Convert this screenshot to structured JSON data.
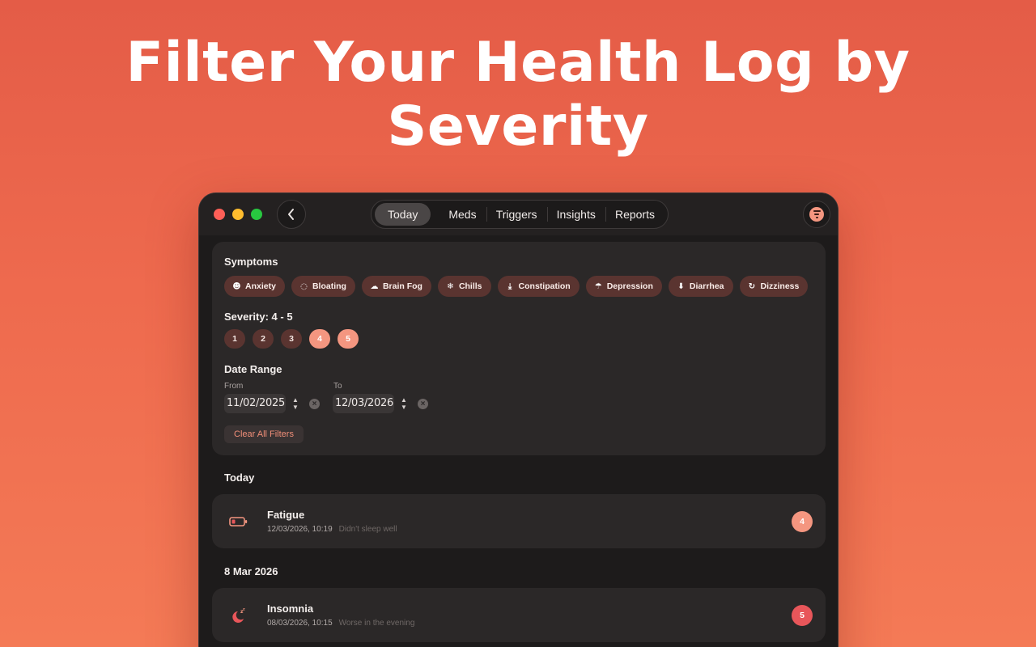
{
  "headline": "Filter Your Health Log by Severity",
  "window": {
    "tabs": [
      {
        "label": "Today",
        "active": true
      },
      {
        "label": "Meds",
        "active": false
      },
      {
        "label": "Triggers",
        "active": false
      },
      {
        "label": "Insights",
        "active": false
      },
      {
        "label": "Reports",
        "active": false
      }
    ],
    "back_icon": "chevron-left-icon",
    "filter_icon": "filter-lines-icon"
  },
  "filters": {
    "symptoms_title": "Symptoms",
    "symptoms": [
      {
        "label": "Anxiety",
        "icon": "brain-head-icon",
        "glyph": "☻"
      },
      {
        "label": "Bloating",
        "icon": "dotted-circle-icon",
        "glyph": "◌"
      },
      {
        "label": "Brain Fog",
        "icon": "cloud-icon",
        "glyph": "☁"
      },
      {
        "label": "Chills",
        "icon": "snowflake-icon",
        "glyph": "❄"
      },
      {
        "label": "Constipation",
        "icon": "arrow-down-to-line-icon",
        "glyph": "⤓"
      },
      {
        "label": "Depression",
        "icon": "cloud-rain-icon",
        "glyph": "☂"
      },
      {
        "label": "Diarrhea",
        "icon": "arrow-down-circle-icon",
        "glyph": "⬇"
      },
      {
        "label": "Dizziness",
        "icon": "rotate-icon",
        "glyph": "↻"
      },
      {
        "label": "",
        "icon": "battery-icon",
        "glyph": "▭"
      }
    ],
    "severity_title": "Severity: 4 - 5",
    "severity_levels": [
      {
        "label": "1",
        "selected": false
      },
      {
        "label": "2",
        "selected": false
      },
      {
        "label": "3",
        "selected": false
      },
      {
        "label": "4",
        "selected": true
      },
      {
        "label": "5",
        "selected": true
      }
    ],
    "date_range_title": "Date Range",
    "from_label": "From",
    "from_value": "11/02/2025",
    "to_label": "To",
    "to_value": "12/03/2026",
    "clear_all_label": "Clear All Filters"
  },
  "log": [
    {
      "group": "Today",
      "entries": [
        {
          "name": "Fatigue",
          "datetime": "12/03/2026, 10:19",
          "note": "Didn't sleep well",
          "severity": "4",
          "icon": "low-battery-icon",
          "badge_color": "#f49680"
        }
      ]
    },
    {
      "group": "8 Mar 2026",
      "entries": [
        {
          "name": "Insomnia",
          "datetime": "08/03/2026, 10:15",
          "note": "Worse in the evening",
          "severity": "5",
          "icon": "moon-zzz-icon",
          "badge_color": "#e8565a"
        }
      ]
    }
  ],
  "colors": {
    "accent": "#f49680",
    "chip_bg": "#5a3430",
    "severity_high": "#e8565a",
    "window_bg": "#1d1b1b",
    "card_bg": "#2b2828"
  }
}
